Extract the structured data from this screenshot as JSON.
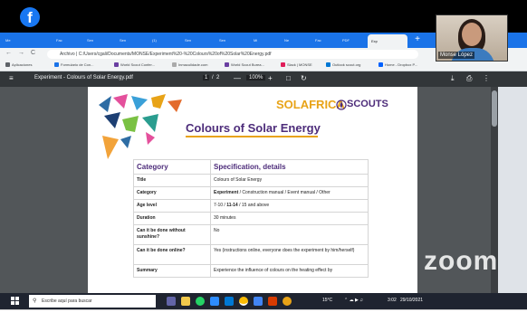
{
  "overlay": {
    "fb_letter": "f"
  },
  "browser": {
    "tabs": [
      "Me",
      "Fac",
      "Sen",
      "Sen",
      "(1)",
      "Sen",
      "Sen",
      "Mi",
      "Ne",
      "Fac",
      "PDF",
      "Exp"
    ],
    "new_tab": "+",
    "nav": {
      "back": "←",
      "forward": "→",
      "reload": "C"
    },
    "url": "Archivo  |  C:/Users/cgali/Documents/MONSE/Experiment%20-%20Colours%20of%20Solar%20Energy.pdf",
    "bookmarks": [
      "Aplicaciones",
      "Formulario de Con...",
      "World Scout Confer...",
      "Inmaculidade.com",
      "World Scout Burea...",
      "Slack | MONSE",
      "Outlook scout.org",
      "Home - Dropbox P..."
    ]
  },
  "viewer": {
    "filename": "Experiment - Colours of Solar Energy.pdf",
    "page": "1",
    "page_sep": "/",
    "page_total": "2",
    "zoom": "100%",
    "zoom_out": "—",
    "zoom_in": "+",
    "fit": "□",
    "rotate": "↻",
    "download": "⤓",
    "print": "⎙",
    "more": "⋮",
    "menu": "≡"
  },
  "document": {
    "brand_left": "SOLAFRICA",
    "brand_right": "SCOUTS",
    "title": "Colours of Solar Energy",
    "headers": [
      "Category",
      "Specification, details"
    ],
    "rows": [
      {
        "label": "Title",
        "value": "Colours of Solar Energy"
      },
      {
        "label": "Category",
        "value_bold": "Experiment",
        "value": " / Construction manual / Event manual / Other"
      },
      {
        "label": "Age level",
        "value_pre": "7-10 / ",
        "value_bold": "11-14",
        "value": " / 15 and above"
      },
      {
        "label": "Duration",
        "value": "30 minutes"
      },
      {
        "label": "Can it be done without sunshine?",
        "value": "No"
      },
      {
        "label": "Can it be done online?",
        "value": "Yes (instructions online, everyone does the experiment by him/herself)"
      },
      {
        "label": "Summary",
        "value": "Experience the influence of colours on the heating effect by"
      }
    ]
  },
  "taskbar": {
    "search_placeholder": "Escribe aquí para buscar",
    "weather": "15°C",
    "time": "3:02",
    "date": "29/10/2021"
  },
  "camera": {
    "name": "Monse López"
  },
  "watermark": "zoom"
}
